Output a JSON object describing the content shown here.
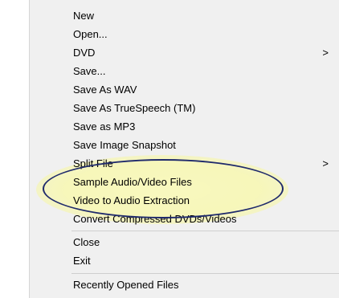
{
  "menu": {
    "items": [
      {
        "label": "New",
        "submenu": false
      },
      {
        "label": "Open...",
        "submenu": false
      },
      {
        "label": "DVD",
        "submenu": true
      },
      {
        "label": "Save...",
        "submenu": false
      },
      {
        "label": "Save As WAV",
        "submenu": false
      },
      {
        "label": "Save As TrueSpeech (TM)",
        "submenu": false
      },
      {
        "label": "Save as MP3",
        "submenu": false
      },
      {
        "label": "Save Image Snapshot",
        "submenu": false
      },
      {
        "label": "Split File",
        "submenu": true
      },
      {
        "label": "Sample Audio/Video Files",
        "submenu": false
      },
      {
        "label": "Video to Audio Extraction",
        "submenu": false
      },
      {
        "label": "Convert Compressed DVDs/Videos",
        "submenu": false
      },
      {
        "label": "Close",
        "submenu": false
      },
      {
        "label": "Exit",
        "submenu": false
      },
      {
        "label": "Recently Opened Files",
        "submenu": false
      }
    ],
    "submenu_arrow": ">"
  },
  "annotation": {
    "shape": "ellipse",
    "stroke_color": "#1f2a6b",
    "glow_color": "#ffff96"
  }
}
